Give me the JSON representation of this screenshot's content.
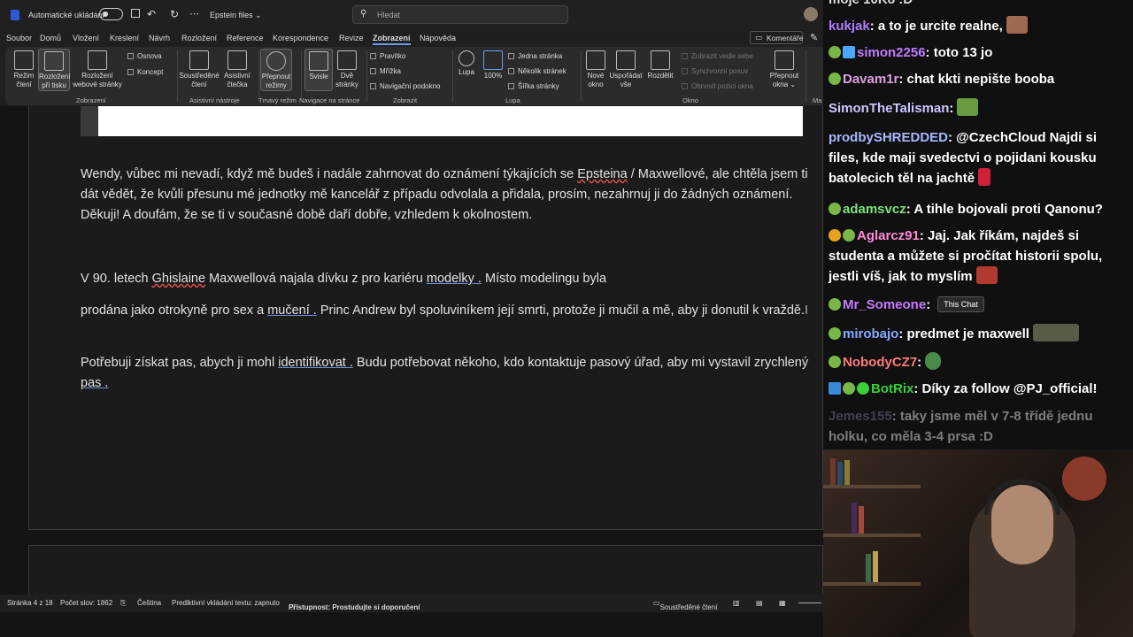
{
  "titlebar": {
    "autosave": "Automatické ukládání",
    "doc_name": "Epstein files",
    "search_placeholder": "Hledat"
  },
  "menu": [
    "Soubor",
    "Domů",
    "Vložení",
    "Kreslení",
    "Návrh",
    "Rozložení",
    "Reference",
    "Korespondence",
    "Revize",
    "Zobrazení",
    "Nápověda"
  ],
  "menu_active": "Zobrazení",
  "comments_button": "Komentáře",
  "ribbon": {
    "rezim_cteni": "Režim\nčtení",
    "rozlozeni_tisku": "Rozložení\npři tisku",
    "webove": "Rozložení\nwebové stránky",
    "osnova": "Osnova",
    "koncept": "Koncept",
    "group_zobrazeni": "Zobrazení",
    "soustredene": "Soustředěné\nčtení",
    "asistivni": "Asistivní\nčtečka",
    "group_asist": "Asistivní nástroje",
    "prepnout": "Přepnout\nrežimy",
    "group_tmavy": "Tmavý režim",
    "svisle": "Svisle",
    "dve": "Dvě\nstránky",
    "group_nav": "Navigace na stránce",
    "pravitko": "Pravítko",
    "mrizka": "Mřížka",
    "navig_podokno": "Navigační podokno",
    "group_zobrazit": "Zobrazit",
    "lupa": "Lupa",
    "lupa100": "100%",
    "jedna": "Jedna stránka",
    "nekolik": "Několik stránek",
    "sirka": "Šířka stránky",
    "group_lupa": "Lupa",
    "nove": "Nové\nokno",
    "usporadat": "Uspořádat\nvše",
    "rozdelit": "Rozdělit",
    "vedle": "Zobrazit vedle sebe",
    "synchronni": "Synchronní posuv",
    "obnovit": "Obnovit pozici okna",
    "prepnout_okna": "Přepnout\nokna",
    "group_okno": "Okno",
    "cut": "Ma"
  },
  "doc": {
    "p1_a": "Wendy, vůbec mi nevadí, když mě budeš i nadále zahrnovat do oznámení týkajících se ",
    "p1_link": "Epsteina",
    "p1_b": " / Maxwellové, ale chtěla jsem ti dát vědět, že kvůli přesunu mé jednotky mě kancelář z případu odvolala a přidala, prosím, nezahrnuj ji do žádných oznámení. Děkuji! A doufám, že se ti v současné době daří dobře, vzhledem k okolnostem.",
    "p2_a": "V 90. letech ",
    "p2_sp": "Ghislaine",
    "p2_b": " Maxwellová najala dívku z pro kariéru ",
    "p2_u": "modelky .",
    "p2_c": " Místo modelingu byla",
    "p3_a": "prodána jako otrokyně pro sex a ",
    "p3_u": "mučení .",
    "p3_b": " Princ Andrew byl spoluviníkem její smrti, protože ji mučil a mě, aby ji donutil k vraždě.",
    "p4_a": "Potřebuji získat pas, abych ji mohl ",
    "p4_u": "identifikovat .",
    "p4_b": " Budu potřebovat někoho, kdo kontaktuje pasový úřad, aby mi vystavil zrychlený ",
    "p4_u2": "pas ."
  },
  "status": {
    "page": "Stránka 4 z 18",
    "words": "Počet slov: 1862",
    "lang": "Čeština",
    "predict": "Prediktivní vkládání textu: zapnuto",
    "access": "Přístupnost: Prostudujte si doporučení",
    "focus": "Soustředěné čtení"
  },
  "chat": [
    {
      "user": "kukjak",
      "color": "#b07cff",
      "text": " a to je urcite realne,"
    },
    {
      "user": "simon2256",
      "color": "#c07cff",
      "text": " toto 13 jo"
    },
    {
      "user": "Davam1r",
      "color": "#e0a0e0",
      "text": " chat kkti nepište booba"
    },
    {
      "user": "SimonTheTalisman",
      "color": "#c8c8ff",
      "text": " "
    },
    {
      "user": "prodbySHREDDED",
      "color": "#a8b8ff",
      "text": " @CzechCloud Najdi si files, kde maji svedectvi o pojidani kousku batolecich těl na jachtě"
    },
    {
      "user": "adamsvcz",
      "color": "#7fe07f",
      "text": " A tihle bojovali proti Qanonu?"
    },
    {
      "user": "Aglarcz91",
      "color": "#ff8ad8",
      "text": " Jaj. Jak říkám, najdeš si studenta a můžete si pročítat historii spolu, jestli víš, jak to myslím"
    },
    {
      "user": "Mr_Someone",
      "color": "#c878ff",
      "text": " "
    },
    {
      "user": "mirobajo",
      "color": "#88a8ff",
      "text": " predmet je maxwell"
    },
    {
      "user": "NobodyCZ7",
      "color": "#ff7a7a",
      "text": " "
    },
    {
      "user": "BotRix",
      "color": "#3ad03a",
      "text": " Díky za follow @PJ_official!"
    },
    {
      "user": "Jemes155",
      "color": "#7a7aa0",
      "text": " taky jsme měl v 7-8 třídě jednu holku, co měla 3-4 prsa :D"
    }
  ],
  "chat_top_partial": "moje 10K8 :D",
  "tooltip": "This Chat"
}
